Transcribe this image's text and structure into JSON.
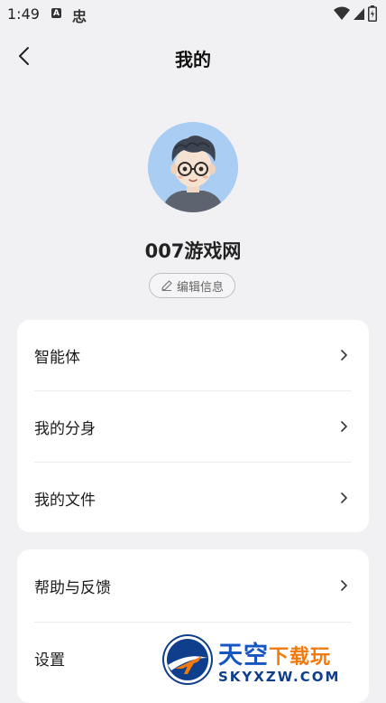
{
  "status_bar": {
    "time": "1:49",
    "notif_a": "A",
    "notif_app": "忠"
  },
  "header": {
    "title": "我的"
  },
  "profile": {
    "name": "007游戏网",
    "edit_label": "编辑信息"
  },
  "menu_group_1": {
    "items": [
      {
        "label": "智能体"
      },
      {
        "label": "我的分身"
      },
      {
        "label": "我的文件"
      }
    ]
  },
  "menu_group_2": {
    "items": [
      {
        "label": "帮助与反馈"
      },
      {
        "label": "设置"
      }
    ]
  },
  "watermark": {
    "title_main": "天空",
    "title_accent": "下载玩",
    "subtitle": "SKYXZW.COM"
  },
  "colors": {
    "background": "#f1f1f3",
    "card": "#ffffff",
    "avatar_bg": "#a9cdf3",
    "watermark_blue": "#1556c2",
    "watermark_orange": "#f07a0c"
  }
}
